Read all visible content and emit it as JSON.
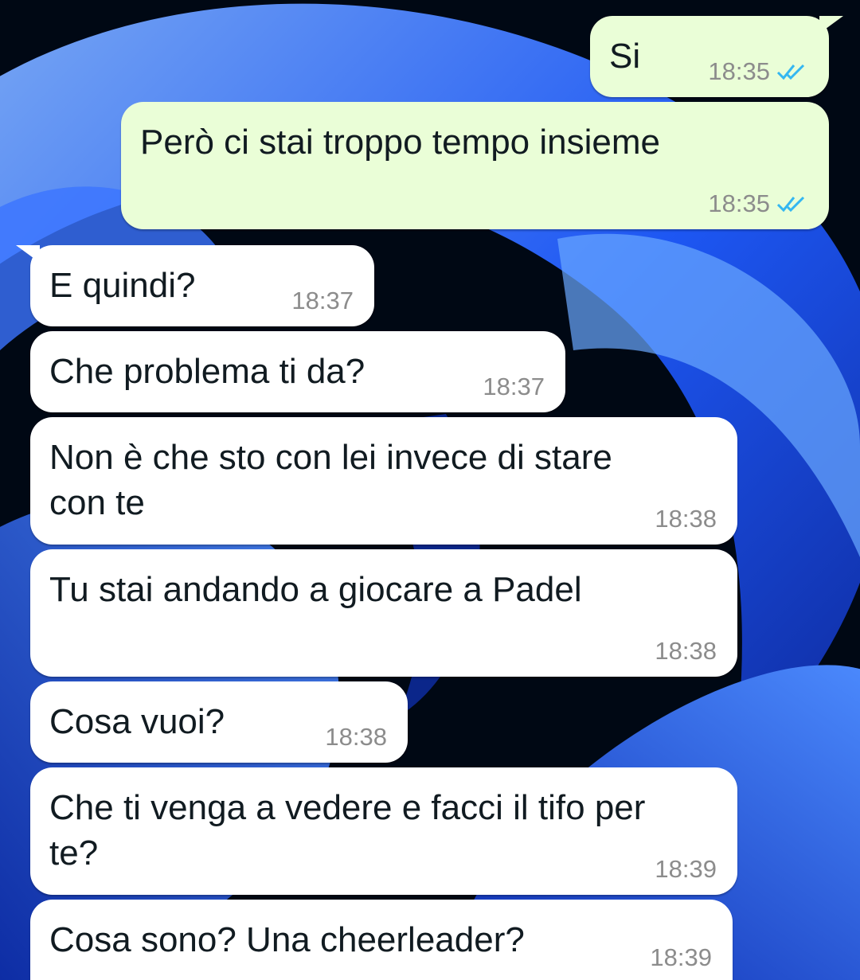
{
  "messages": [
    {
      "text": "Si",
      "time": "18:35",
      "direction": "out",
      "status": "read-double-check"
    },
    {
      "text": "Però ci stai troppo tempo insieme",
      "time": "18:35",
      "direction": "out",
      "status": "read-double-check"
    },
    {
      "text": "E quindi?",
      "time": "18:37",
      "direction": "in"
    },
    {
      "text": "Che problema ti da?",
      "time": "18:37",
      "direction": "in"
    },
    {
      "text": "Non è che sto con lei invece di stare\ncon te",
      "time": "18:38",
      "direction": "in"
    },
    {
      "text": "Tu stai andando a giocare a Padel",
      "time": "18:38",
      "direction": "in"
    },
    {
      "text": "Cosa vuoi?",
      "time": "18:38",
      "direction": "in"
    },
    {
      "text": "Che ti venga a vedere e facci il tifo per\nte?",
      "time": "18:39",
      "direction": "in"
    },
    {
      "text": "Cosa sono? Una cheerleader?",
      "time": "18:39",
      "direction": "in"
    }
  ],
  "colors": {
    "outgoing_bubble": "#eafed7",
    "incoming_bubble": "#ffffff",
    "read_tick": "#34b7f1",
    "timestamp": "#8c8c8c",
    "wallpaper_dark": "#000814",
    "wallpaper_blue": "#1a4fd6"
  },
  "icons": {
    "read_receipt": "double-check-icon"
  }
}
